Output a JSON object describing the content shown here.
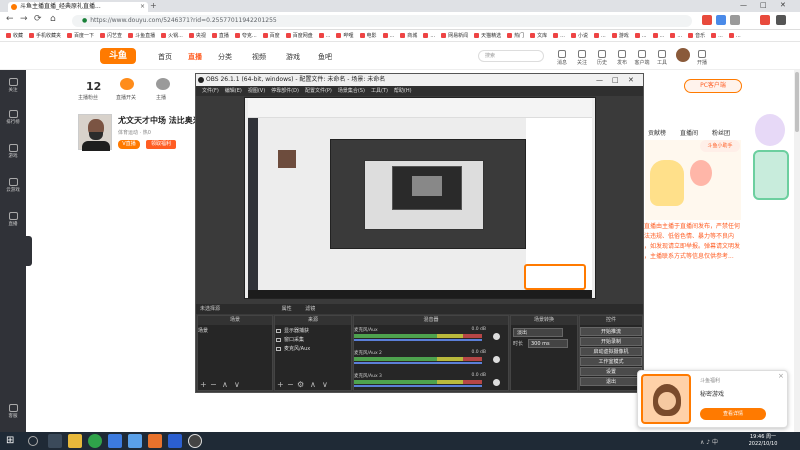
{
  "browser": {
    "tab_title": "斗鱼主播直播_经典原礼直播...",
    "tab_close": "×",
    "newtab": "+",
    "url": "https://www.douyu.com/5246371?rid=0.25577011942201255",
    "nav": {
      "back": "←",
      "forward": "→",
      "reload": "⟳",
      "home": "⌂"
    },
    "window": {
      "min": "—",
      "max": "□",
      "close": "✕"
    },
    "bookmarks": [
      "收藏",
      "手机收藏夹",
      "百度一下",
      "闪艺查",
      "斗鱼直播",
      "火锅...",
      "央视",
      "直播",
      "夸克...",
      "百度",
      "百度网盘",
      "...",
      "哔哩",
      "电影",
      "...",
      "商城",
      "...",
      "网易新闻",
      "天猫精选",
      "热门",
      "文库",
      "...",
      "小说",
      "...",
      "游戏",
      "...",
      "...",
      "...",
      "音乐",
      "...",
      "..."
    ]
  },
  "douyu": {
    "logo": "斗鱼",
    "nav": [
      "首页",
      "直播",
      "分类",
      "视频",
      "游戏",
      "鱼吧"
    ],
    "nav_active": "直播",
    "search_placeholder": "搜索",
    "header_icons": [
      "消息",
      "关注",
      "历史",
      "发布",
      "客户端",
      "工具",
      "开播"
    ],
    "pc_button": "PC客户端",
    "stats": {
      "count": "12",
      "labels": [
        "主播粉丝",
        "直播开关",
        "主播"
      ]
    },
    "streamer": {
      "title": "尤文天才中场 法比奥米...",
      "meta": "体育运动 · 热0",
      "tag": "V直播",
      "tag2": "领取福利"
    },
    "right_tabs": [
      "贡献榜",
      "直播间",
      "粉丝团"
    ],
    "bubble": "斗鱼小助手",
    "notice": "本直播由主播于直播间发布，严禁任何违法违规、低俗色情、暴力等不良内容，如发现请立即举报。弹幕请文明发言，主播联系方式等信息仅供参考..."
  },
  "sidebar": [
    "关注",
    "排行榜",
    "游戏",
    "云游戏",
    "直播",
    "客服"
  ],
  "obs": {
    "title": "OBS 26.1.1 (64-bit, windows) - 配置文件: 未命名 - 场景: 未命名",
    "menu": [
      "文件(F)",
      "编辑(E)",
      "视图(V)",
      "停靠部件(D)",
      "配置文件(P)",
      "场景集合(S)",
      "工具(T)",
      "帮助(H)"
    ],
    "dock_header": [
      "未选择源",
      "属性",
      "滤镜"
    ],
    "docks": {
      "scenes": "场景",
      "sources": "来源",
      "mixer": "混音器",
      "transitions": "场景转换",
      "controls": "控件"
    },
    "scene_items": [
      "场景"
    ],
    "source_items": [
      "显示器捕获",
      "窗口采集",
      "麦克风/Aux"
    ],
    "mixer_items": [
      {
        "name": "麦克风/Aux",
        "db": "0.0 dB"
      },
      {
        "name": "麦克风/Aux 2",
        "db": "0.0 dB"
      },
      {
        "name": "麦克风/Aux 3",
        "db": "0.0 dB"
      }
    ],
    "transition": {
      "type": "淡出",
      "duration_label": "时长",
      "duration": "300 ms"
    },
    "controls": [
      "开始推流",
      "开始录制",
      "启动虚拟摄像机",
      "工作室模式",
      "设置",
      "退出"
    ],
    "footer": [
      "+",
      "−",
      "⚙",
      "∧",
      "∨"
    ]
  },
  "notification": {
    "from": "斗鱼福利",
    "title": "秘密游戏",
    "button": "查看详情",
    "close": "×"
  },
  "taskbar": {
    "start": "⊞",
    "tray": "∧  ♪  中",
    "time": "19:46 周一",
    "date": "2022/10/10"
  },
  "colors": {
    "accent": "#ff7a00",
    "obs_bg": "#3a3a3a",
    "taskbar": "#1f2a36"
  }
}
